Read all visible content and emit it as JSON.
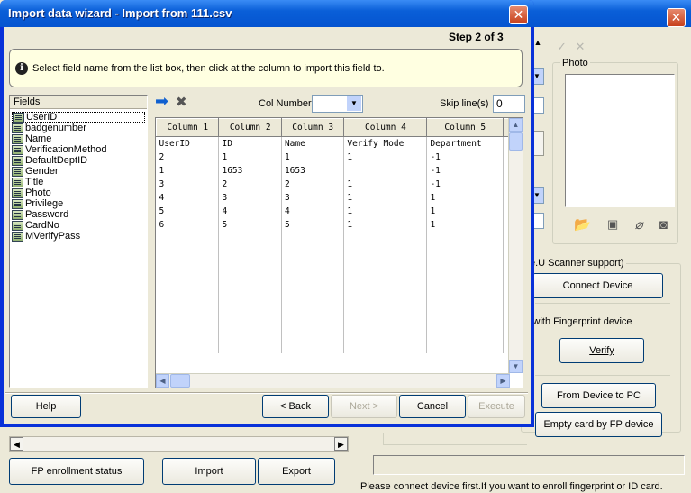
{
  "parent": {
    "photo_label": "Photo",
    "scanner_label": "e.U Scanner support)",
    "connect_device": "Connect Device",
    "fingerprint_label": "l with Fingerprint device",
    "verify": "Verify",
    "from_device_to_pc": "From Device to PC",
    "empty_card": "Empty card by FP device",
    "fp_enrollment_status": "FP enrollment status",
    "import": "Import",
    "export": "Export",
    "status_message": "Please connect device first.If you want to enroll fingerprint or ID card."
  },
  "dialog": {
    "title": "Import data wizard - Import from 111.csv",
    "step": "Step 2 of 3",
    "instruction": "Select field name from the list box, then click at the column to import this field to.",
    "fields_header": "Fields",
    "fields": [
      "UserID",
      "badgenumber",
      "Name",
      "VerificationMethod",
      "DefaultDeptID",
      "Gender",
      "Title",
      "Photo",
      "Privilege",
      "Password",
      "CardNo",
      "MVerifyPass"
    ],
    "col_number_label": "Col Number",
    "col_number_value": "",
    "skip_lines_label": "Skip line(s)",
    "skip_lines_value": "0",
    "grid": {
      "headers": [
        "Column_1",
        "Column_2",
        "Column_3",
        "Column_4",
        "Column_5"
      ],
      "rows": [
        [
          "UserID",
          "ID",
          "Name",
          "Verify Mode",
          "Department"
        ],
        [
          "2",
          "1",
          "1",
          "1",
          "-1"
        ],
        [
          "1",
          "1653",
          "1653",
          "",
          "-1"
        ],
        [
          "3",
          "2",
          "2",
          "1",
          "-1"
        ],
        [
          "4",
          "3",
          "3",
          "1",
          "1"
        ],
        [
          "5",
          "4",
          "4",
          "1",
          "1"
        ],
        [
          "6",
          "5",
          "5",
          "1",
          "1"
        ]
      ]
    },
    "buttons": {
      "help": "Help",
      "back": "< Back",
      "next": "Next >",
      "cancel": "Cancel",
      "execute": "Execute"
    }
  },
  "icons": {
    "arrow": "arrow-right-icon",
    "delete": "delete-x-icon",
    "close": "close-icon"
  },
  "colors": {
    "titlebar": "#0554d0",
    "dialog_border": "#0831d9",
    "instruction_bg": "#ffffe1",
    "arrow_blue": "#1060d0"
  }
}
